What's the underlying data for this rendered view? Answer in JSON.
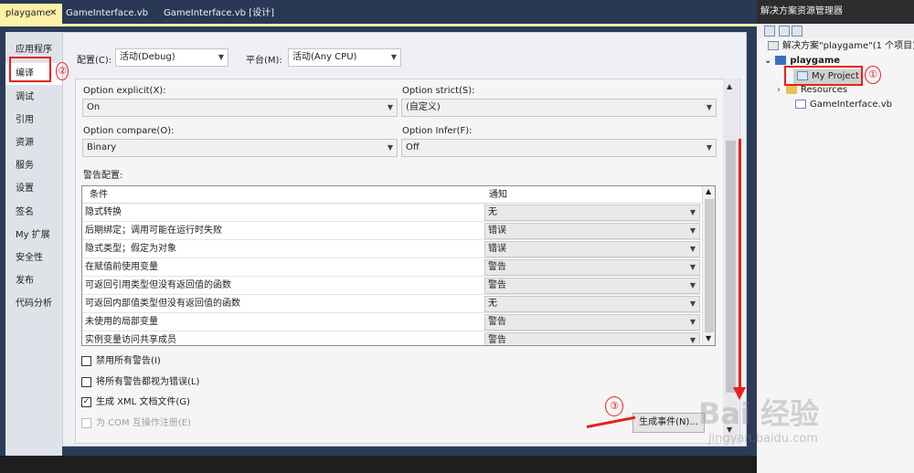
{
  "tabs": [
    {
      "label": "playgame",
      "active": true
    },
    {
      "label": "GameInterface.vb",
      "active": false
    },
    {
      "label": "GameInterface.vb [设计]",
      "active": false
    }
  ],
  "tab_close": "✕",
  "nav": [
    "应用程序",
    "编译",
    "调试",
    "引用",
    "资源",
    "服务",
    "设置",
    "签名",
    "My 扩展",
    "安全性",
    "发布",
    "代码分析"
  ],
  "nav_active_index": 1,
  "config": {
    "label": "配置(C):",
    "value": "活动(Debug)"
  },
  "platform": {
    "label": "平台(M):",
    "value": "活动(Any CPU)"
  },
  "options": {
    "explicit_label": "Option explicit(X):",
    "explicit_value": "On",
    "strict_label": "Option strict(S):",
    "strict_value": "(自定义)",
    "compare_label": "Option compare(O):",
    "compare_value": "Binary",
    "infer_label": "Option Infer(F):",
    "infer_value": "Off"
  },
  "warnings_label": "警告配置:",
  "warnings_table": {
    "headers": [
      "条件",
      "通知"
    ],
    "rows": [
      [
        "隐式转换",
        "无"
      ],
      [
        "后期绑定；调用可能在运行时失败",
        "错误"
      ],
      [
        "隐式类型；假定为对象",
        "错误"
      ],
      [
        "在赋值前使用变量",
        "警告"
      ],
      [
        "可返回引用类型但没有返回值的函数",
        "警告"
      ],
      [
        "可返回内部值类型但没有返回值的函数",
        "无"
      ],
      [
        "未使用的局部变量",
        "警告"
      ],
      [
        "实例变量访问共享成员",
        "警告"
      ]
    ]
  },
  "checkboxes": [
    {
      "label": "禁用所有警告(I)",
      "checked": false,
      "disabled": false
    },
    {
      "label": "将所有警告都视为错误(L)",
      "checked": false,
      "disabled": false
    },
    {
      "label": "生成 XML 文档文件(G)",
      "checked": true,
      "disabled": false
    },
    {
      "label": "为 COM 互操作注册(E)",
      "checked": false,
      "disabled": true
    }
  ],
  "build_events_button": "生成事件(N)...",
  "explorer": {
    "title": "解决方案资源管理器",
    "solution": "解决方案\"playgame\"(1 个项目)",
    "project": "playgame",
    "items": [
      "My Project",
      "Resources",
      "GameInterface.vb"
    ]
  },
  "annotations": [
    "①",
    "②",
    "③"
  ],
  "watermark": {
    "main": "Bai 经验",
    "sub": "jingyan.baidu.com"
  },
  "colors": {
    "accent_red": "#e8201a",
    "tab_active": "#fff1a8",
    "chrome": "#293955"
  }
}
